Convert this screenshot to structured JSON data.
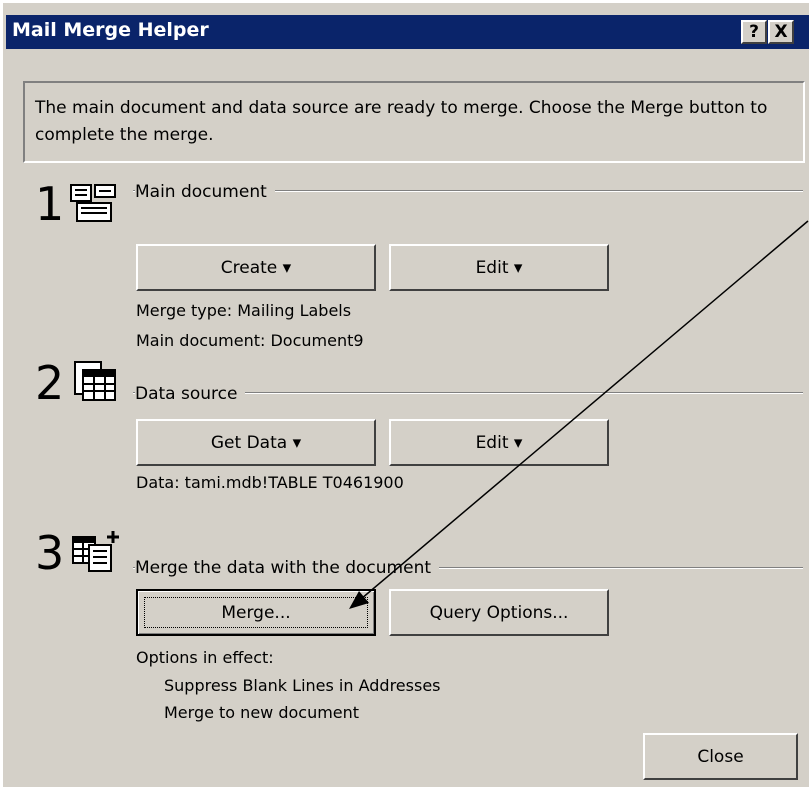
{
  "window": {
    "title": "Mail Merge Helper",
    "help_glyph": "?",
    "close_glyph": "X"
  },
  "intro_text": "The main document and data source are ready to merge. Choose the Merge button to complete the merge.",
  "steps": [
    {
      "number": "1",
      "icon": "main-document-icon",
      "label": "Main document",
      "buttons": [
        "Create ▾",
        "Edit ▾"
      ],
      "info": [
        "Merge type: Mailing Labels",
        "Main document: Document9"
      ]
    },
    {
      "number": "2",
      "icon": "data-source-icon",
      "label": "Data source",
      "buttons": [
        "Get Data ▾",
        "Edit ▾"
      ],
      "info": [
        "Data: tami.mdb!TABLE T0461900"
      ]
    },
    {
      "number": "3",
      "icon": "merge-icon",
      "label": "Merge the data with the document",
      "buttons": [
        "Merge...",
        "Query Options..."
      ],
      "info": [
        "Options in effect:",
        "Suppress Blank Lines in Addresses",
        "Merge to new document"
      ]
    }
  ],
  "close_button": "Close",
  "colors": {
    "title_bar": "#0a246a",
    "face": "#d4d0c8",
    "arrow": "#000000"
  }
}
